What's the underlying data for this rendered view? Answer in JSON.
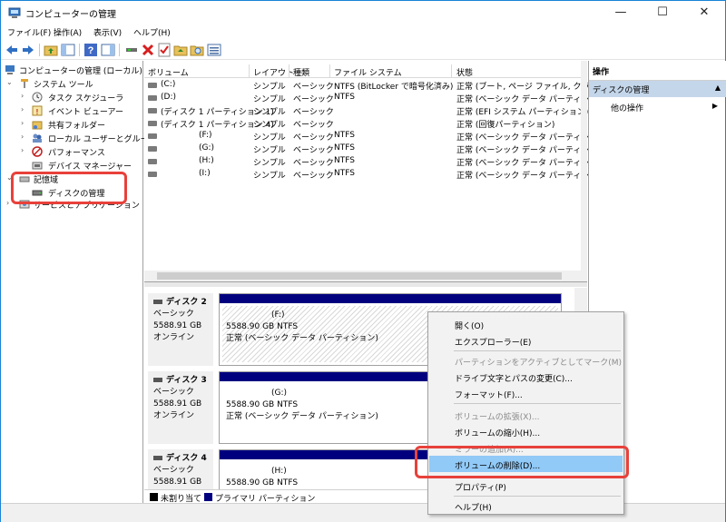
{
  "window": {
    "title": "コンピューターの管理",
    "controls": {
      "minimize": "—",
      "maximize": "☐",
      "close": "✕"
    }
  },
  "menu": [
    "ファイル(F)",
    "操作(A)",
    "表示(V)",
    "ヘルプ(H)"
  ],
  "tree": {
    "root": "コンピューターの管理 (ローカル)",
    "system_tools": "システム ツール",
    "task_scheduler": "タスク スケジューラ",
    "event_viewer": "イベント ビューアー",
    "shared_folders": "共有フォルダー",
    "local_users": "ローカル ユーザーとグループ",
    "performance": "パフォーマンス",
    "device_manager": "デバイス マネージャー",
    "storage": "記憶域",
    "disk_management": "ディスクの管理",
    "services_apps": "サービスとアプリケーション"
  },
  "volume_list": {
    "columns": [
      "ボリューム",
      "レイアウト",
      "種類",
      "ファイル システム",
      "状態"
    ],
    "rows": [
      [
        "(C:)",
        "シンプル",
        "ベーシック",
        "NTFS (BitLocker で暗号化済み)",
        "正常 (ブート, ページ ファイル, クラッシュ"
      ],
      [
        "(D:)",
        "シンプル",
        "ベーシック",
        "NTFS",
        "正常 (ベーシック データ パーティション)"
      ],
      [
        "(ディスク 1 パーティション 1)",
        "シンプル",
        "ベーシック",
        "",
        "正常 (EFI システム パーティション)"
      ],
      [
        "(ディスク 1 パーティション 4)",
        "シンプル",
        "ベーシック",
        "",
        "正常 (回復パーティション)"
      ],
      [
        "(F:)",
        "シンプル",
        "ベーシック",
        "NTFS",
        "正常 (ベーシック データ パーティション)"
      ],
      [
        "(G:)",
        "シンプル",
        "ベーシック",
        "NTFS",
        "正常 (ベーシック データ パーティション)"
      ],
      [
        "(H:)",
        "シンプル",
        "ベーシック",
        "NTFS",
        "正常 (ベーシック データ パーティション)"
      ],
      [
        "(I:)",
        "シンプル",
        "ベーシック",
        "NTFS",
        "正常 (ベーシック データ パーティション)"
      ]
    ]
  },
  "disks": [
    {
      "name": "ディスク 2",
      "type": "ベーシック",
      "size": "5588.91 GB",
      "status": "オンライン",
      "vol": "(F:)",
      "vol_size": "5588.90 GB NTFS",
      "vol_status": "正常 (ベーシック データ パーティション)"
    },
    {
      "name": "ディスク 3",
      "type": "ベーシック",
      "size": "5588.91 GB",
      "status": "オンライン",
      "vol": "(G:)",
      "vol_size": "5588.90 GB NTFS",
      "vol_status": "正常 (ベーシック データ パーティション)"
    },
    {
      "name": "ディスク 4",
      "type": "ベーシック",
      "size": "5588.91 GB",
      "status": "",
      "vol": "(H:)",
      "vol_size": "5588.90 GB NTFS",
      "vol_status": ""
    }
  ],
  "legend": {
    "unallocated": "未割り当て",
    "primary": "プライマリ パーティション"
  },
  "actions": {
    "title": "操作",
    "section": "ディスクの管理",
    "other": "他の操作"
  },
  "context_menu": [
    {
      "label": "開く(O)",
      "enabled": true
    },
    {
      "label": "エクスプローラー(E)",
      "enabled": true
    },
    {
      "label": "パーティションをアクティブとしてマーク(M)",
      "enabled": false
    },
    {
      "label": "ドライブ文字とパスの変更(C)...",
      "enabled": true
    },
    {
      "label": "フォーマット(F)...",
      "enabled": true
    },
    {
      "label": "ボリュームの拡張(X)...",
      "enabled": false
    },
    {
      "label": "ボリュームの縮小(H)...",
      "enabled": true
    },
    {
      "label": "ミラーの追加(A)...",
      "enabled": false
    },
    {
      "label": "ボリュームの削除(D)...",
      "enabled": true,
      "highlighted": true
    },
    {
      "label": "プロパティ(P)",
      "enabled": true
    },
    {
      "label": "ヘルプ(H)",
      "enabled": true
    }
  ],
  "colors": {
    "primary_partition": "#00007f",
    "unallocated": "#000000",
    "highlight": "#91c9f7",
    "callout": "#e8413b",
    "action_section": "#c4d6ea"
  }
}
